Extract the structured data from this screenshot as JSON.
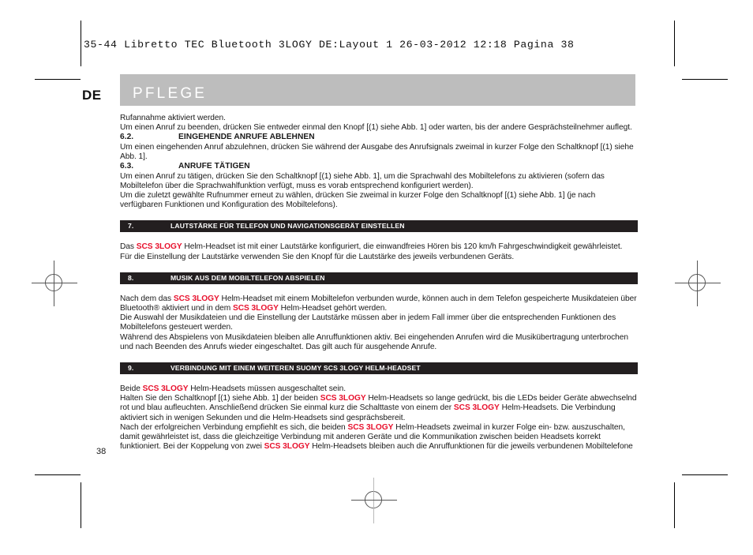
{
  "film_slug": "35-44 Libretto TEC Bluetooth 3LOGY DE:Layout 1   26-03-2012   12:18   Pagina 38",
  "header": {
    "language_code": "DE",
    "chapter_title": "PFLEGE",
    "band_color": "#bdbdbd",
    "title_color": "#ffffff"
  },
  "brand": {
    "name": "SCS 3LOGY",
    "color": "#e8112d"
  },
  "folio": "38",
  "intro": {
    "line_1": "Rufannahme aktiviert werden.",
    "line_2": "Um einen Anruf zu beenden, drücken Sie entweder einmal den Knopf [(1) siehe Abb. 1] oder warten, bis der andere Gesprächsteilnehmer auflegt."
  },
  "subsections": [
    {
      "number": "6.2.",
      "title": "EINGEHENDE ANRUFE ABLEHNEN",
      "body": "Um einen eingehenden Anruf abzulehnen, drücken Sie während der Ausgabe des Anrufsignals zweimal in kurzer Folge den Schaltknopf [(1) siehe Abb. 1]."
    },
    {
      "number": "6.3.",
      "title": "ANRUFE TÄTIGEN",
      "body_1": "Um einen Anruf zu tätigen, drücken Sie den Schaltknopf [(1) siehe Abb. 1], um die Sprachwahl des Mobiltelefons zu aktivieren (sofern das Mobiltelefon über die Sprachwahlfunktion verfügt, muss es vorab entsprechend konfiguriert werden).",
      "body_2": "Um die zuletzt gewählte Rufnummer erneut zu wählen, drücken Sie zweimal in kurzer Folge den Schaltknopf [(1) siehe Abb. 1] (je nach verfügbaren Funktionen und Konfiguration des Mobiltelefons)."
    }
  ],
  "sections": [
    {
      "number": "7.",
      "title": "LAUTSTÄRKE FÜR TELEFON UND NAVIGATIONSGERÄT EINSTELLEN",
      "para_1_pre": "Das ",
      "para_1_brand": "SCS 3LOGY",
      "para_1_post": " Helm-Headset ist mit einer Lautstärke konfiguriert, die einwandfreies Hören bis 120 km/h Fahrgeschwindigkeit gewährleistet.",
      "para_2": "Für die Einstellung der Lautstärke verwenden Sie den Knopf für die Lautstärke des jeweils verbundenen Geräts."
    },
    {
      "number": "8.",
      "title": "MUSIK AUS DEM MOBILTELEFON ABSPIELEN",
      "para_1_a": "Nach dem das ",
      "para_1_brand_1": "SCS 3LOGY",
      "para_1_b": " Helm-Headset mit einem Mobiltelefon verbunden wurde, können auch in dem Telefon gespeicherte Musikdateien über Bluetooth® aktiviert und in dem ",
      "para_1_brand_2": "SCS 3LOGY",
      "para_1_c": " Helm-Headset gehört werden.",
      "para_2": "Die Auswahl der Musikdateien und die Einstellung der Lautstärke müssen aber in jedem Fall immer über die entsprechenden Funktionen des Mobiltelefons gesteuert werden.",
      "para_3": "Während des Abspielens von Musikdateien bleiben alle Anruffunktionen aktiv. Bei eingehenden Anrufen wird die Musikübertragung unterbrochen und nach Beenden des Anrufs wieder eingeschaltet. Das gilt auch für ausgehende Anrufe."
    },
    {
      "number": "9.",
      "title": "VERBINDUNG MIT EINEM WEITEREN SUOMY SCS 3LOGY HELM-HEADSET",
      "para_1_a": "Beide ",
      "para_1_brand_1": "SCS 3LOGY",
      "para_1_b": " Helm-Headsets müssen ausgeschaltet sein.",
      "para_2_a": "Halten Sie den Schaltknopf [(1) siehe Abb. 1] der beiden ",
      "para_2_brand_1": "SCS 3LOGY",
      "para_2_b": " Helm-Headsets so lange gedrückt, bis die LEDs beider Geräte abwechselnd rot und blau aufleuchten. Anschließend drücken Sie einmal kurz die Schalttaste von einem der ",
      "para_2_brand_2": "SCS 3LOGY",
      "para_2_c": " Helm-Headsets. Die Verbindung aktiviert sich in wenigen Sekunden und die Helm-Headsets sind gesprächsbereit.",
      "para_3_a": "Nach der erfolgreichen Verbindung empfiehlt es sich, die beiden ",
      "para_3_brand_1": "SCS 3LOGY",
      "para_3_b": " Helm-Headsets zweimal in kurzer Folge ein- bzw. auszuschalten, damit gewährleistet ist, dass die gleichzeitige Verbindung mit anderen Geräte und die Kommunikation zwischen beiden Headsets korrekt funktioniert. Bei der Koppelung von zwei ",
      "para_3_brand_2": "SCS 3LOGY",
      "para_3_c": " Helm-Headsets bleiben auch die Anruffunktionen für die jeweils verbundenen Mobiltelefone"
    }
  ]
}
